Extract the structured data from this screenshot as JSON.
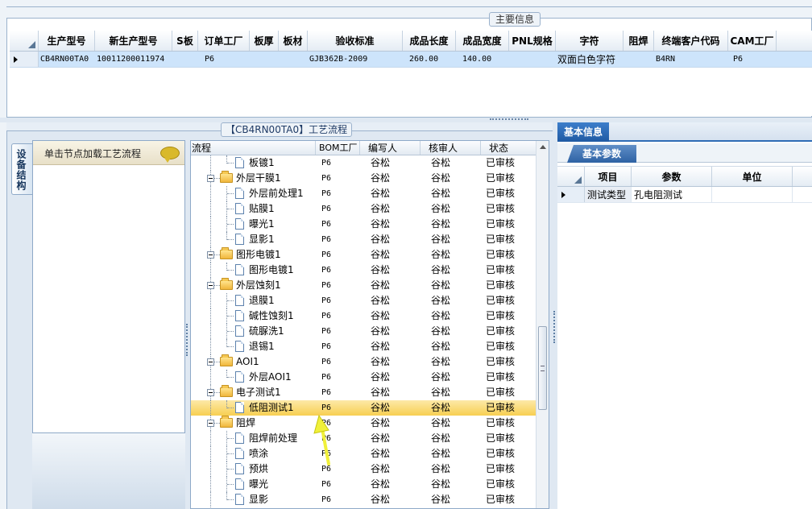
{
  "main_info": {
    "title": "主要信息",
    "columns": [
      "生产型号",
      "新生产型号",
      "S板",
      "订单工厂",
      "板厚",
      "板材",
      "验收标准",
      "成品长度",
      "成品宽度",
      "PNL规格",
      "字符",
      "阻焊",
      "终端客户代码",
      "CAM工厂"
    ],
    "rows": [
      [
        "CB4RN00TA0",
        "10011200011974",
        "",
        "P6",
        "",
        "",
        "GJB362B-2009",
        "260.00",
        "140.00",
        "",
        "双面白色字符",
        "",
        "B4RN",
        "P6"
      ]
    ]
  },
  "process": {
    "title": "【CB4RN00TA0】工艺流程",
    "side_tab": "设备结构",
    "node_hint": "单击节点加载工艺流程",
    "columns": [
      "流程",
      "BOM工厂",
      "编写人",
      "核审人",
      "状态"
    ],
    "rows": [
      {
        "level": 2,
        "type": "doc",
        "name": "板镀1",
        "bom": "P6",
        "author": "谷松",
        "reviewer": "谷松",
        "status": "已审核"
      },
      {
        "level": 1,
        "type": "folder",
        "name": "外层干膜1",
        "bom": "P6",
        "author": "谷松",
        "reviewer": "谷松",
        "status": "已审核"
      },
      {
        "level": 2,
        "type": "doc",
        "name": "外层前处理1",
        "bom": "P6",
        "author": "谷松",
        "reviewer": "谷松",
        "status": "已审核"
      },
      {
        "level": 2,
        "type": "doc",
        "name": "贴膜1",
        "bom": "P6",
        "author": "谷松",
        "reviewer": "谷松",
        "status": "已审核"
      },
      {
        "level": 2,
        "type": "doc",
        "name": "曝光1",
        "bom": "P6",
        "author": "谷松",
        "reviewer": "谷松",
        "status": "已审核"
      },
      {
        "level": 2,
        "type": "doc",
        "name": "显影1",
        "bom": "P6",
        "author": "谷松",
        "reviewer": "谷松",
        "status": "已审核"
      },
      {
        "level": 1,
        "type": "folder",
        "name": "图形电镀1",
        "bom": "P6",
        "author": "谷松",
        "reviewer": "谷松",
        "status": "已审核"
      },
      {
        "level": 2,
        "type": "doc",
        "name": "图形电镀1",
        "bom": "P6",
        "author": "谷松",
        "reviewer": "谷松",
        "status": "已审核"
      },
      {
        "level": 1,
        "type": "folder",
        "name": "外层蚀刻1",
        "bom": "P6",
        "author": "谷松",
        "reviewer": "谷松",
        "status": "已审核"
      },
      {
        "level": 2,
        "type": "doc",
        "name": "退膜1",
        "bom": "P6",
        "author": "谷松",
        "reviewer": "谷松",
        "status": "已审核"
      },
      {
        "level": 2,
        "type": "doc",
        "name": "碱性蚀刻1",
        "bom": "P6",
        "author": "谷松",
        "reviewer": "谷松",
        "status": "已审核"
      },
      {
        "level": 2,
        "type": "doc",
        "name": "硫脲洗1",
        "bom": "P6",
        "author": "谷松",
        "reviewer": "谷松",
        "status": "已审核"
      },
      {
        "level": 2,
        "type": "doc",
        "name": "退锡1",
        "bom": "P6",
        "author": "谷松",
        "reviewer": "谷松",
        "status": "已审核"
      },
      {
        "level": 1,
        "type": "folder",
        "name": "AOI1",
        "bom": "P6",
        "author": "谷松",
        "reviewer": "谷松",
        "status": "已审核"
      },
      {
        "level": 2,
        "type": "doc",
        "name": "外层AOI1",
        "bom": "P6",
        "author": "谷松",
        "reviewer": "谷松",
        "status": "已审核"
      },
      {
        "level": 1,
        "type": "folder",
        "name": "电子测试1",
        "bom": "P6",
        "author": "谷松",
        "reviewer": "谷松",
        "status": "已审核"
      },
      {
        "level": 2,
        "type": "doc",
        "name": "低阻测试1",
        "bom": "P6",
        "author": "谷松",
        "reviewer": "谷松",
        "status": "已审核",
        "selected": true
      },
      {
        "level": 1,
        "type": "folder",
        "name": "阻焊",
        "bom": "P6",
        "author": "谷松",
        "reviewer": "谷松",
        "status": "已审核"
      },
      {
        "level": 2,
        "type": "doc",
        "name": "阻焊前处理",
        "bom": "P6",
        "author": "谷松",
        "reviewer": "谷松",
        "status": "已审核"
      },
      {
        "level": 2,
        "type": "doc",
        "name": "喷涂",
        "bom": "P6",
        "author": "谷松",
        "reviewer": "谷松",
        "status": "已审核"
      },
      {
        "level": 2,
        "type": "doc",
        "name": "预烘",
        "bom": "P6",
        "author": "谷松",
        "reviewer": "谷松",
        "status": "已审核"
      },
      {
        "level": 2,
        "type": "doc",
        "name": "曝光",
        "bom": "P6",
        "author": "谷松",
        "reviewer": "谷松",
        "status": "已审核"
      },
      {
        "level": 2,
        "type": "doc",
        "name": "显影",
        "bom": "P6",
        "author": "谷松",
        "reviewer": "谷松",
        "status": "已审核"
      }
    ]
  },
  "basic_info": {
    "tab": "基本信息",
    "subtab": "基本参数",
    "columns": [
      "项目",
      "参数",
      "单位"
    ],
    "rows": [
      [
        "测试类型",
        "孔电阻测试",
        ""
      ]
    ]
  },
  "colors": {
    "accent": "#2e6bb5",
    "selection": "#f7cf52",
    "grid_selection": "#cde4fb",
    "annotation_arrow": "#f0f03a"
  }
}
